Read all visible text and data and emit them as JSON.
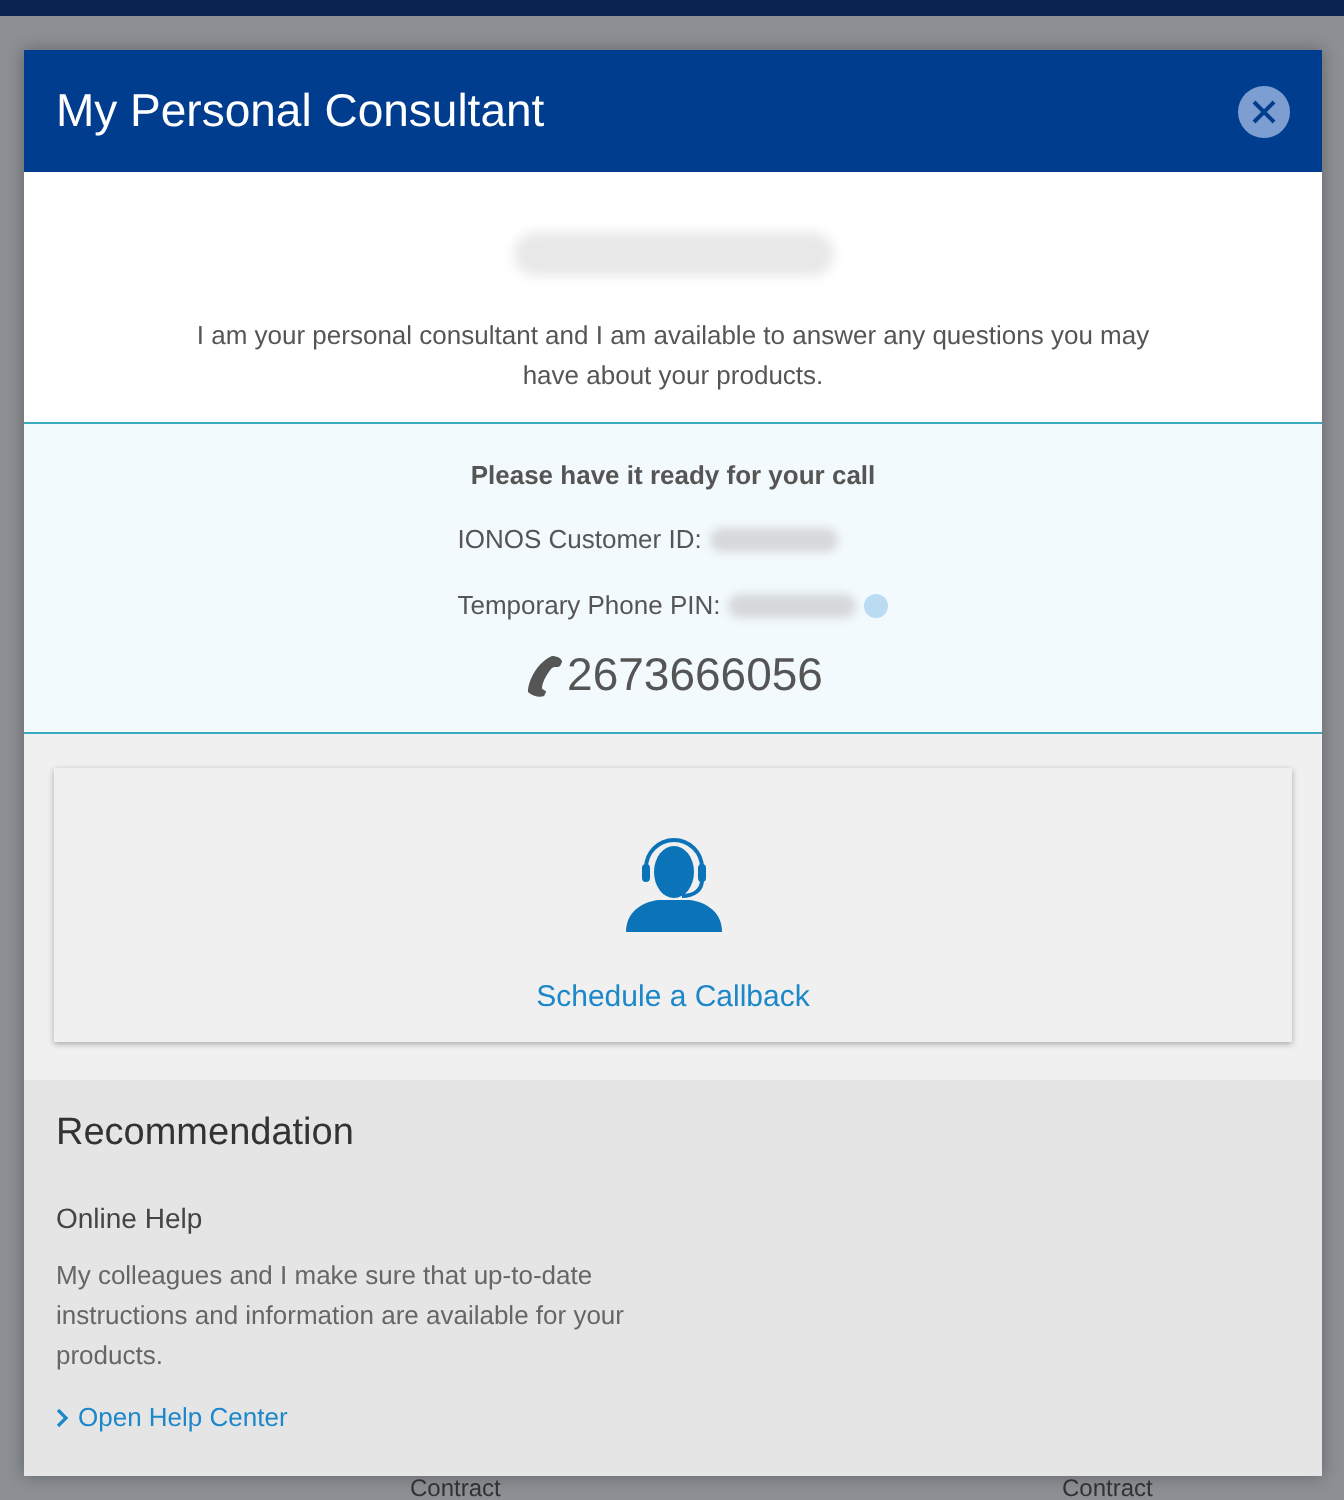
{
  "background": {
    "labels": [
      "Contract",
      "Contract"
    ]
  },
  "modal": {
    "title": "My Personal Consultant",
    "intro": "I am your personal consultant and I am available to answer any questions you may have about your products.",
    "call_info": {
      "heading": "Please have it ready for your call",
      "fields": [
        {
          "label": "IONOS Customer ID:",
          "info": false
        },
        {
          "label": "Temporary Phone PIN:",
          "info": true
        }
      ],
      "phone": "2673666056"
    },
    "callback": {
      "label": "Schedule a Callback"
    },
    "recommendation": {
      "heading": "Recommendation",
      "title": "Online Help",
      "text": "My colleagues and I make sure that up-to-date instructions and information are available for your products.",
      "link": "Open Help Center"
    }
  }
}
